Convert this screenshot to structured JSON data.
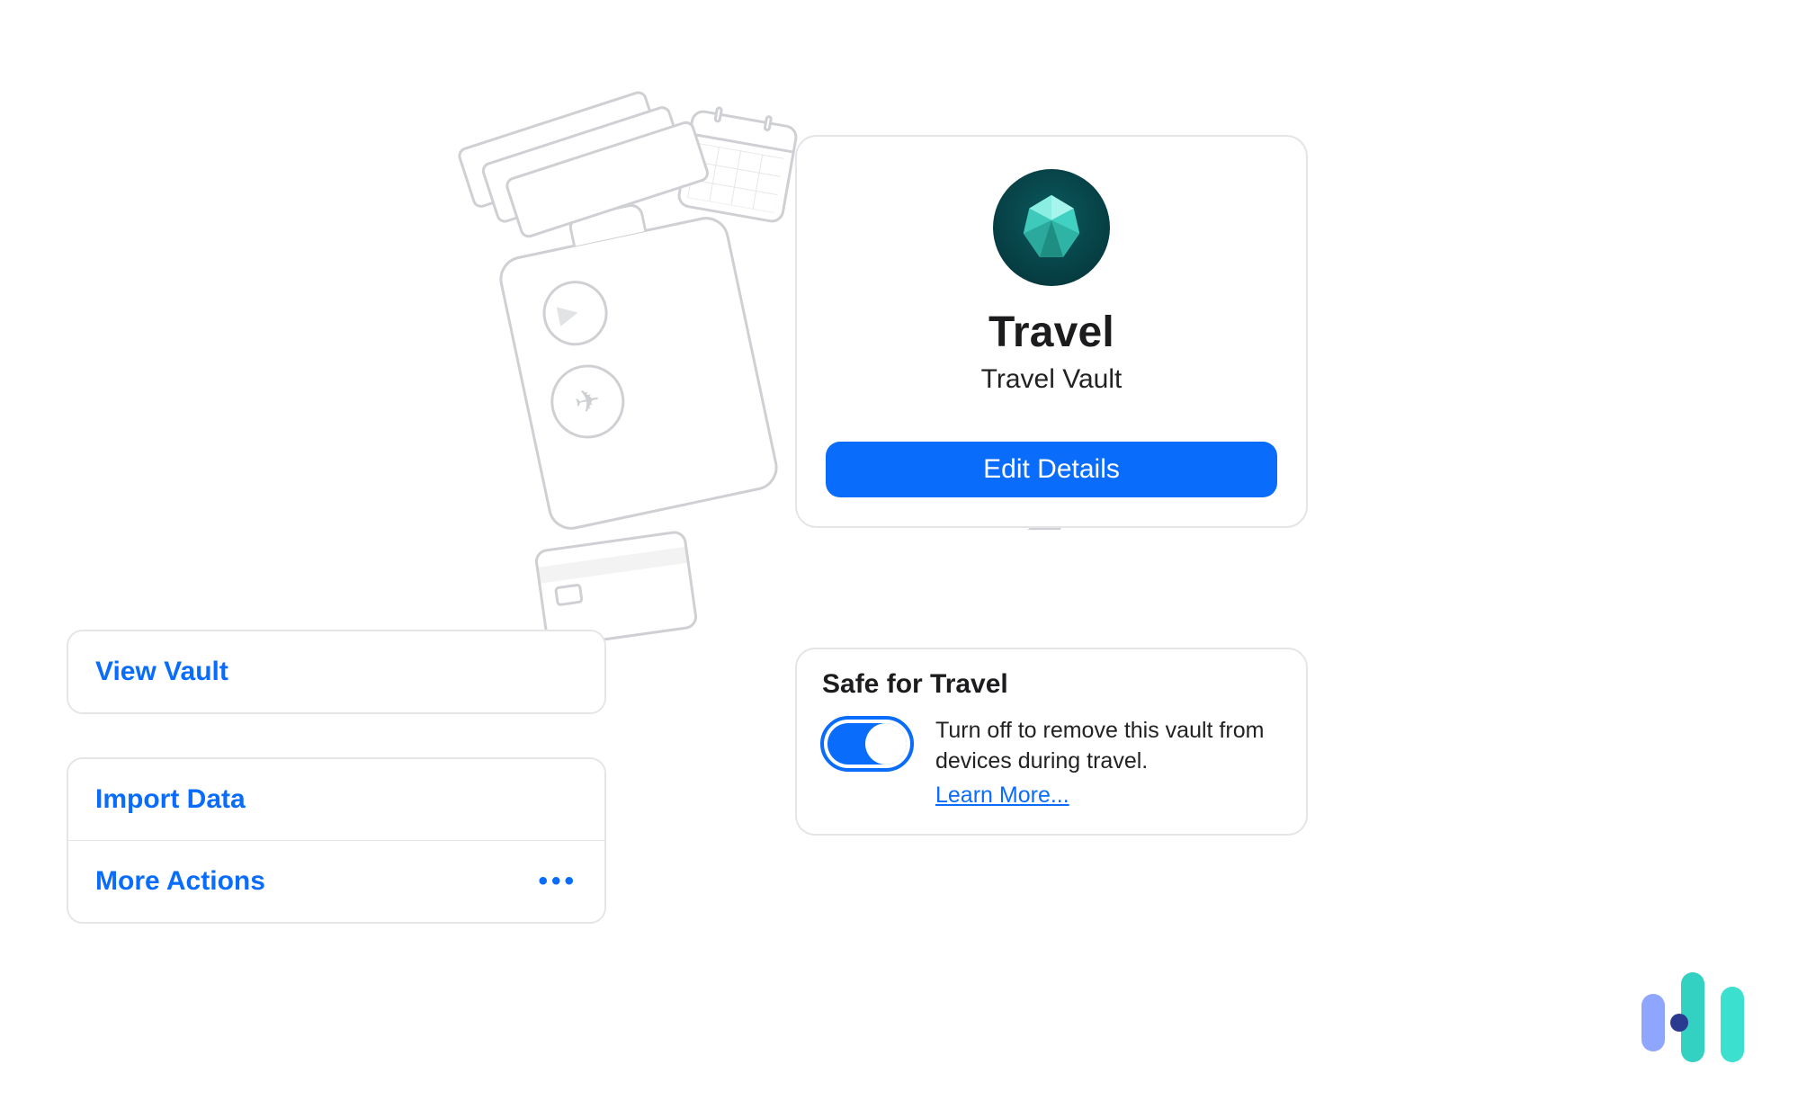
{
  "vault": {
    "title": "Travel",
    "subtitle": "Travel Vault",
    "edit_button": "Edit Details",
    "icon_name": "gem-icon"
  },
  "safe_for_travel": {
    "heading": "Safe for Travel",
    "toggle_on": true,
    "description": "Turn off to remove this vault from devices during travel.",
    "learn_more": "Learn More..."
  },
  "actions": {
    "view_vault": "View Vault",
    "import_data": "Import Data",
    "more_actions": "More Actions"
  },
  "colors": {
    "primary": "#0a6cfb",
    "vault_icon_bg": "#063d42",
    "vault_icon_gem": "#57dacb"
  }
}
